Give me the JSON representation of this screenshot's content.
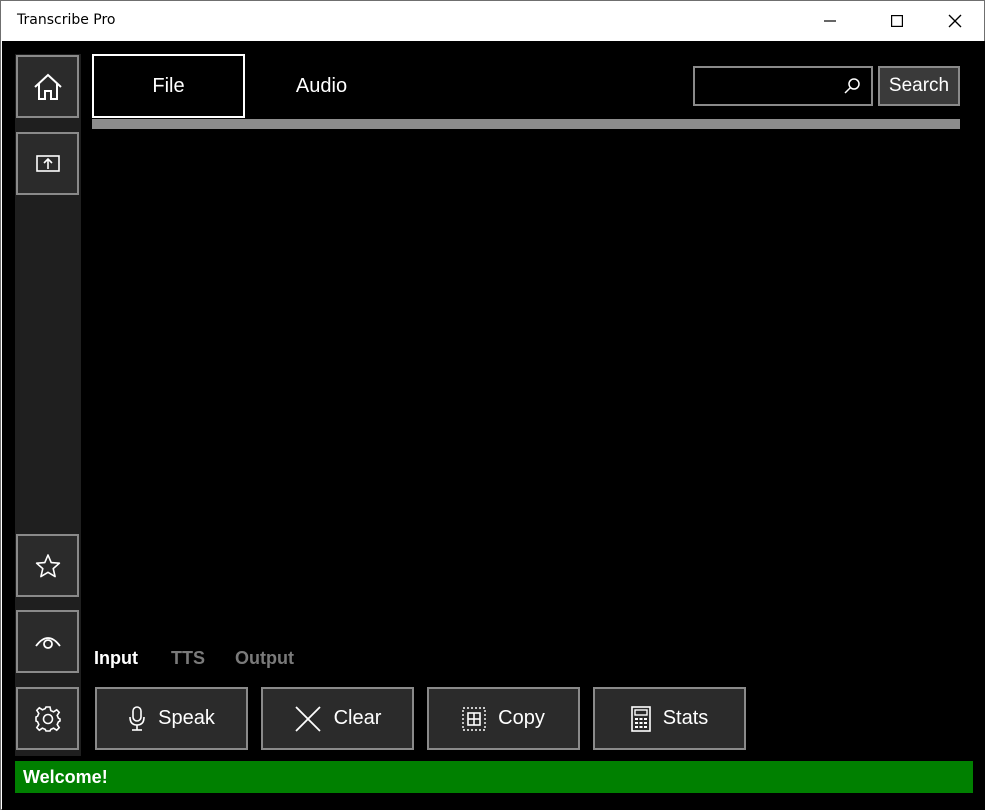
{
  "window": {
    "title": "Transcribe Pro",
    "controls": [
      "minimize-icon",
      "maximize-icon",
      "close-icon"
    ]
  },
  "sidebar": {
    "items": [
      {
        "name": "home",
        "icon": "home-icon"
      },
      {
        "name": "upload",
        "icon": "upload-screen-icon"
      },
      {
        "name": "favorites",
        "icon": "star-icon"
      },
      {
        "name": "view",
        "icon": "eye-icon"
      },
      {
        "name": "settings",
        "icon": "gear-icon"
      }
    ]
  },
  "tabs": [
    {
      "label": "File",
      "selected": true
    },
    {
      "label": "Audio",
      "selected": false
    }
  ],
  "search": {
    "value": "",
    "placeholder": "",
    "button_label": "Search",
    "icon": "search-icon"
  },
  "progress": {
    "fraction": 1.0
  },
  "subtabs": [
    {
      "label": "Input",
      "active": true
    },
    {
      "label": "TTS",
      "active": false
    },
    {
      "label": "Output",
      "active": false
    }
  ],
  "actions": [
    {
      "label": "Speak",
      "icon": "microphone-icon"
    },
    {
      "label": "Clear",
      "icon": "clear-x-icon"
    },
    {
      "label": "Copy",
      "icon": "copy-icon"
    },
    {
      "label": "Stats",
      "icon": "calculator-icon"
    }
  ],
  "status": {
    "text": "Welcome!",
    "color": "#008000"
  },
  "colors": {
    "background": "#000000",
    "sidebar": "#1f1f1f",
    "button_border": "#8a8a8a",
    "button_fill": "#2b2b2b"
  }
}
